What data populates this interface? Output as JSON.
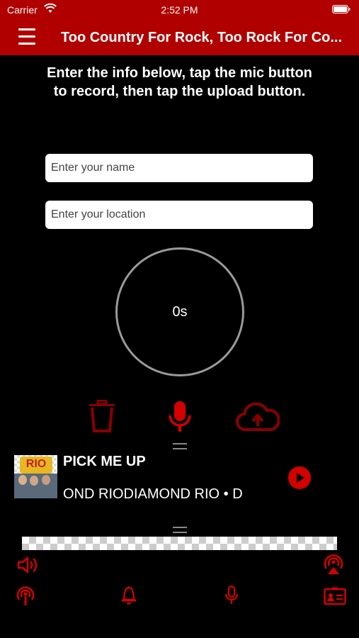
{
  "status_bar": {
    "carrier": "Carrier",
    "time": "2:52 PM"
  },
  "nav": {
    "title": "Too Country For Rock, Too Rock For Co..."
  },
  "instructions": "Enter the info below, tap the mic button to record, then tap the upload button.",
  "form": {
    "name_placeholder": "Enter your name",
    "location_placeholder": "Enter your location"
  },
  "timer": {
    "value": "0s"
  },
  "now_playing": {
    "title": "PICK ME UP",
    "artist": "OND RIODIAMOND RIO • D",
    "album_art_text": "RIO"
  },
  "colors": {
    "accent": "#b00000",
    "icon_red": "#d40000",
    "background": "#000000"
  },
  "icons": [
    "menu-icon",
    "wifi-icon",
    "battery-icon",
    "trash-icon",
    "microphone-icon",
    "cloud-upload-icon",
    "play-icon",
    "speaker-icon",
    "broadcast-icon",
    "podcast-icon",
    "bell-icon",
    "microphone-tab-icon",
    "contact-card-icon"
  ]
}
